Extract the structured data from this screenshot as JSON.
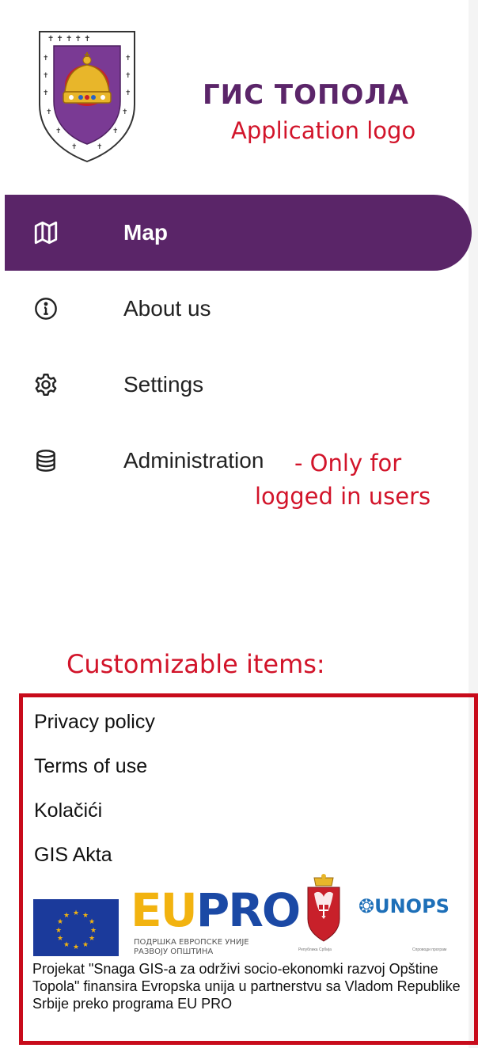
{
  "header": {
    "app_title": "ГИС ТОПОЛА",
    "annotation": "Application logo"
  },
  "nav": {
    "items": [
      {
        "label": "Map",
        "icon": "map-icon",
        "active": true
      },
      {
        "label": "About us",
        "icon": "info-icon",
        "active": false
      },
      {
        "label": "Settings",
        "icon": "gear-icon",
        "active": false
      },
      {
        "label": "Administration",
        "icon": "database-icon",
        "active": false
      }
    ],
    "admin_annotation_line1": "- Only for",
    "admin_annotation_line2": "logged in users"
  },
  "custom": {
    "annotation": "Customizable items:",
    "links": [
      "Privacy policy",
      "Terms of use",
      "Kolačići",
      "GIS Akta"
    ],
    "logos": {
      "eu_word": "EU",
      "pro_word": "PRO",
      "eupro_subtitle_1": "ПОДРШКА ЕВРОПСКЕ УНИЈЕ",
      "eupro_subtitle_2": "РАЗВОЈУ ОПШТИНА",
      "serbia_caption": "Република Србија",
      "unops": "UNOPS",
      "unops_caption": "Спроводи програм"
    },
    "funding_text": "Projekat \"Snaga GIS-a za održivi socio-ekonomki razvoj Opštine Topola\" finansira Evropska unija u partnerstvu sa Vladom Republike Srbije preko programa EU PRO"
  },
  "colors": {
    "brand_purple": "#5a2568",
    "annotation_red": "#d2142a",
    "box_red": "#c80b1b",
    "eu_blue": "#1b3a9b",
    "eu_yellow": "#f2b310"
  }
}
